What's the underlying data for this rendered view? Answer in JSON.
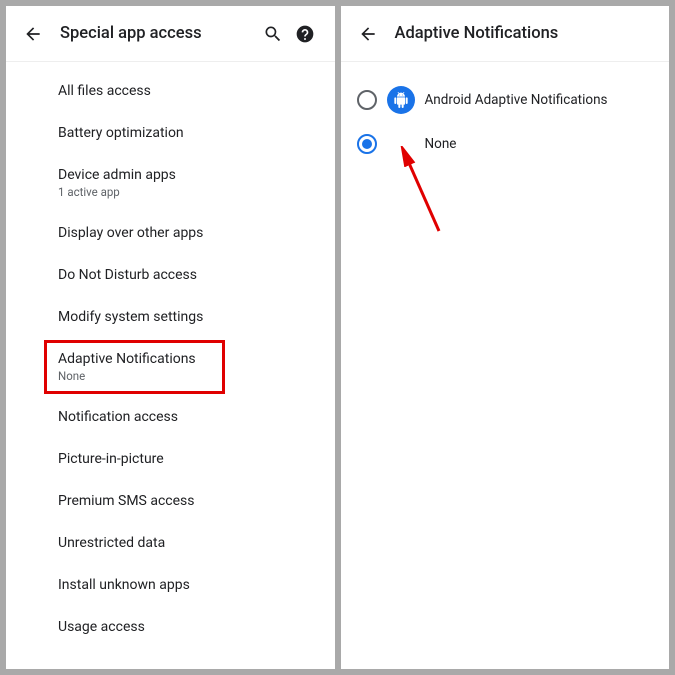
{
  "left": {
    "title": "Special app access",
    "items": [
      {
        "label": "All files access"
      },
      {
        "label": "Battery optimization"
      },
      {
        "label": "Device admin apps",
        "sub": "1 active app"
      },
      {
        "label": "Display over other apps"
      },
      {
        "label": "Do Not Disturb access"
      },
      {
        "label": "Modify system settings"
      },
      {
        "label": "Adaptive Notifications",
        "sub": "None",
        "highlight": true
      },
      {
        "label": "Notification access"
      },
      {
        "label": "Picture-in-picture"
      },
      {
        "label": "Premium SMS access"
      },
      {
        "label": "Unrestricted data"
      },
      {
        "label": "Install unknown apps"
      },
      {
        "label": "Usage access"
      }
    ]
  },
  "right": {
    "title": "Adaptive Notifications",
    "options": [
      {
        "label": "Android Adaptive Notifications",
        "selected": false,
        "icon": "android"
      },
      {
        "label": "None",
        "selected": true
      }
    ]
  },
  "icons": {
    "back": "back-arrow-icon",
    "search": "search-icon",
    "help": "help-icon",
    "android": "android-icon"
  },
  "colors": {
    "highlight": "#e00000",
    "accent": "#1a73e8"
  }
}
